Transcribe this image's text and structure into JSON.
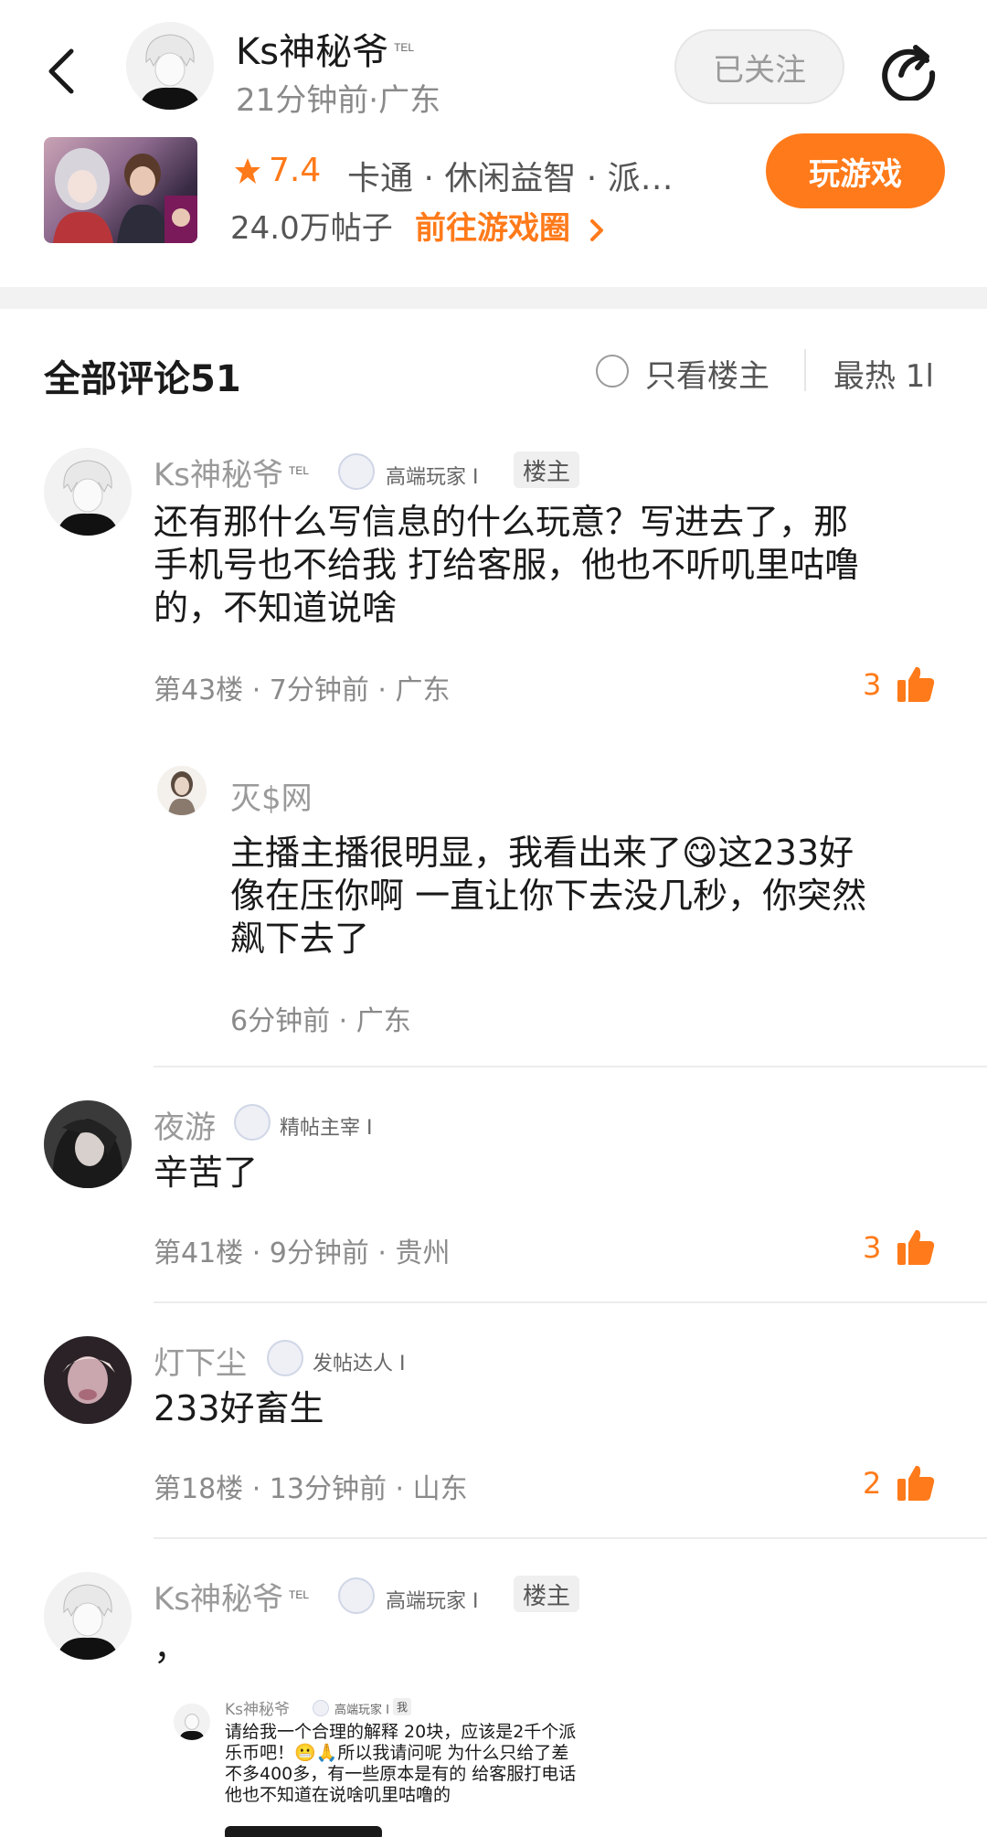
{
  "header": {
    "author_name": "Ks神秘爷",
    "author_tag": "TEL",
    "time_location": "21分钟前·广东",
    "follow_label": "已关注"
  },
  "game": {
    "rating": "7.4",
    "tags": "卡通 · 休闲益智 · 派…",
    "posts": "24.0万帖子",
    "circle_link": "前往游戏圈",
    "play_label": "玩游戏"
  },
  "comments_header": {
    "title": "全部评论51",
    "only_op": "只看楼主",
    "sort": "最热 1l"
  },
  "comments": [
    {
      "name": "Ks神秘爷",
      "tag": "TEL",
      "badge": "高端玩家 I",
      "op_tag": "楼主",
      "lines": [
        "还有那什么写信息的什么玩意？写进去了，那",
        "手机号也不给我 打给客服，他也不听叽里咕噜",
        "的，不知道说啥"
      ],
      "meta": "第43楼 · 7分钟前 · 广东",
      "likes": "3"
    },
    {
      "name": "灭$网",
      "lines": [
        "主播主播很明显，我看出来了😋这233好",
        "像在压你啊 一直让你下去没几秒，你突然",
        "飙下去了"
      ],
      "meta": "6分钟前 · 广东"
    },
    {
      "name": "夜游",
      "badge": "精帖主宰 I",
      "lines": [
        "辛苦了"
      ],
      "meta": "第41楼 · 9分钟前 · 贵州",
      "likes": "3"
    },
    {
      "name": "灯下尘",
      "badge": "发帖达人 I",
      "lines": [
        "233好畜生"
      ],
      "meta": "第18楼 · 13分钟前 · 山东",
      "likes": "2"
    },
    {
      "name": "Ks神秘爷",
      "tag": "TEL",
      "badge": "高端玩家 I",
      "op_tag": "楼主",
      "lines": [
        "，"
      ]
    }
  ],
  "embedded": {
    "name": "Ks神秘爷",
    "badge": "高端玩家 I",
    "tag": "我",
    "lines": [
      "请给我一个合理的解释 20块，应该是2千个派",
      "乐币吧！😬🙏所以我请问呢 为什么只给了差",
      "不多400多，有一些原本是有的 给客服打电话",
      "他也不知道在说啥叽里咕噜的"
    ]
  },
  "colors": {
    "accent": "#ff7a1a",
    "muted": "#9a9a9a",
    "divider": "#ececec"
  },
  "icons": [
    "back-icon",
    "share-icon",
    "star-icon",
    "chevron-right-icon",
    "radio-icon",
    "thumbs-up-icon",
    "badge-icon"
  ]
}
